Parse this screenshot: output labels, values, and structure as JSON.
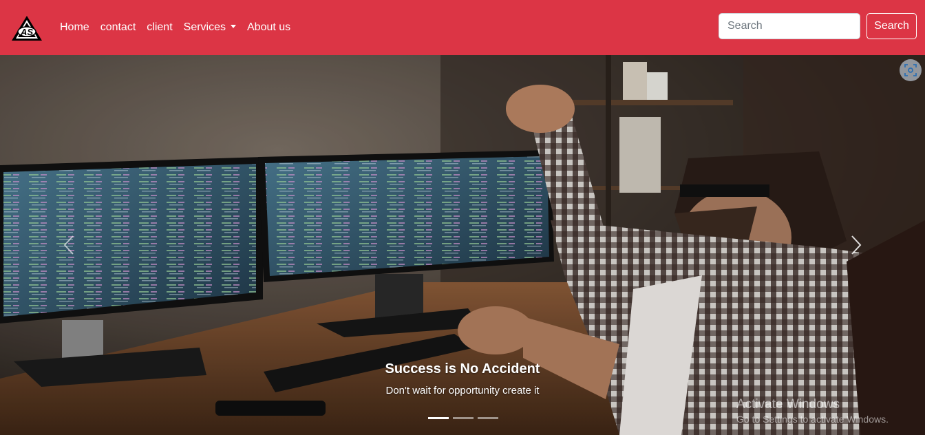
{
  "navbar": {
    "brand_text": "AS",
    "links": [
      "Home",
      "contact",
      "client",
      "Services",
      "About us"
    ],
    "search_placeholder": "Search",
    "search_button": "Search",
    "accent_color": "#dc3545"
  },
  "carousel": {
    "caption_title": "Success is No Accident",
    "caption_text": "Don't wait for opportunity create it",
    "slide_count": 3,
    "active_slide": 0,
    "prev_icon": "chevron-left-icon",
    "next_icon": "chevron-right-icon"
  },
  "overlay": {
    "lens_icon": "visual-search-icon",
    "watermark_title": "Activate Windows",
    "watermark_subtitle": "Go to Settings to activate Windows."
  }
}
